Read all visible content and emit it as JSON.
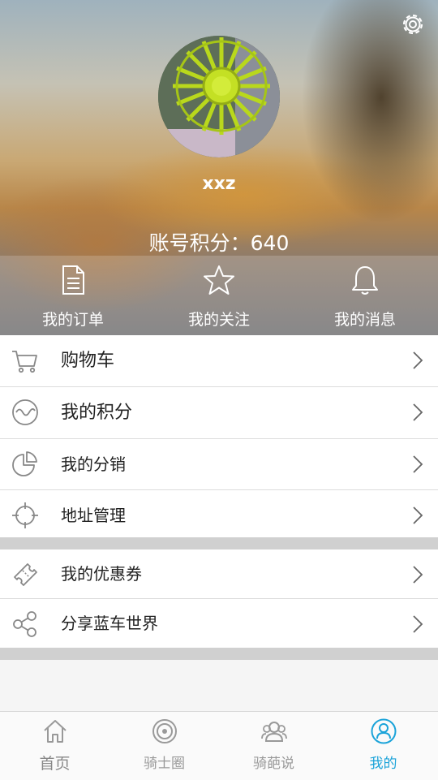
{
  "header": {
    "username": "xxz",
    "points_text": "账号积分：640"
  },
  "quick_actions": [
    {
      "label": "我的订单",
      "icon": "document-icon"
    },
    {
      "label": "我的关注",
      "icon": "star-icon"
    },
    {
      "label": "我的消息",
      "icon": "bell-icon"
    }
  ],
  "menu_group_1": [
    {
      "label": "购物车",
      "icon": "cart-icon"
    },
    {
      "label": "我的积分",
      "icon": "points-icon"
    },
    {
      "label": "我的分销",
      "icon": "pie-chart-icon"
    },
    {
      "label": "地址管理",
      "icon": "location-target-icon"
    }
  ],
  "menu_group_2": [
    {
      "label": "我的优惠券",
      "icon": "coupon-icon"
    },
    {
      "label": "分享蓝车世界",
      "icon": "share-icon"
    }
  ],
  "tabs": [
    {
      "label": "首页",
      "icon": "home-icon"
    },
    {
      "label": "骑士圈",
      "icon": "circle-target-icon"
    },
    {
      "label": "骑葩说",
      "icon": "group-icon"
    },
    {
      "label": "我的",
      "icon": "profile-icon",
      "active": true
    }
  ],
  "colors": {
    "accent": "#1aa3d9",
    "divider": "#d0d0d0"
  }
}
